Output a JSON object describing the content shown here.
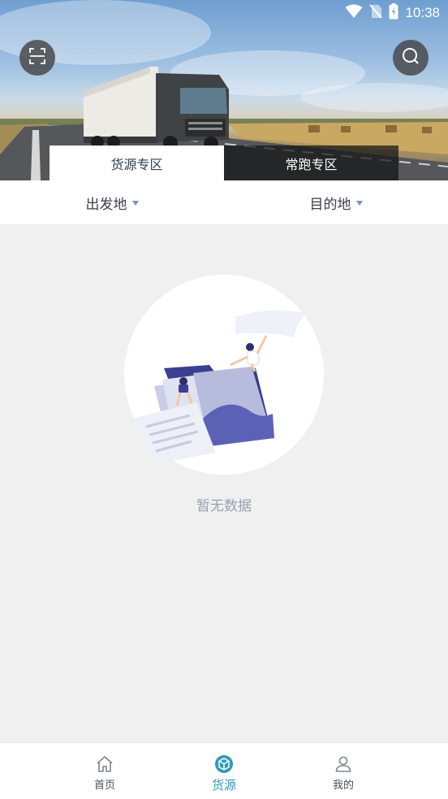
{
  "status_bar": {
    "time": "10:38"
  },
  "header": {
    "scan_icon": "scan-icon",
    "search_icon": "search-icon"
  },
  "tabs": [
    {
      "label": "货源专区",
      "active": true
    },
    {
      "label": "常跑专区",
      "active": false
    }
  ],
  "filters": {
    "origin_label": "出发地",
    "destination_label": "目的地"
  },
  "empty_state": {
    "message": "暂无数据"
  },
  "bottom_nav": {
    "items": [
      {
        "label": "首页",
        "icon": "home-icon",
        "active": false
      },
      {
        "label": "货源",
        "icon": "cube-icon",
        "active": true
      },
      {
        "label": "我的",
        "icon": "user-icon",
        "active": false
      }
    ]
  },
  "colors": {
    "accent": "#2f9bb8",
    "filter_caret": "#6e97c4",
    "empty_text": "#98a0b4",
    "background": "#f0f0f0"
  }
}
